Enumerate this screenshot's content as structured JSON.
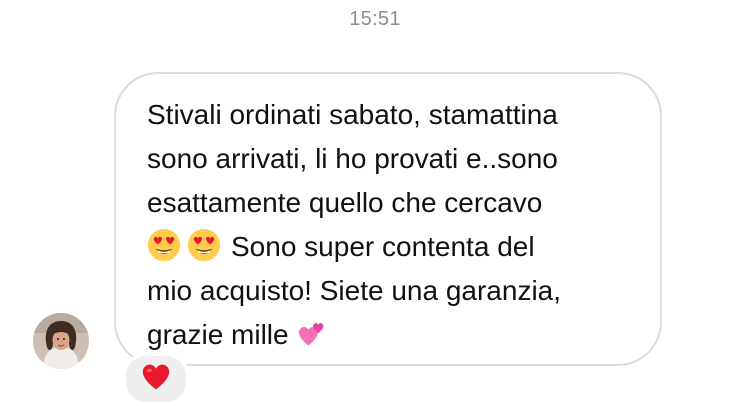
{
  "timestamp": "15:51",
  "message": {
    "lines": [
      {
        "text": "Stivali ordinati sabato, stamattina"
      },
      {
        "text": "sono arrivati, li ho provati e..sono"
      },
      {
        "text": "esattamente quello che cercavo"
      },
      {
        "emojis": [
          "heart-eyes-emoji",
          "heart-eyes-emoji"
        ],
        "text": "Sono super contenta del"
      },
      {
        "text": "mio acquisto! Siete una garanzia,"
      },
      {
        "text": "grazie mille",
        "trailing_emoji": "two-hearts-emoji"
      }
    ]
  },
  "sender": {
    "avatar_icon": "user-avatar"
  },
  "reaction": {
    "icon": "red-heart-emoji"
  },
  "colors": {
    "bubble_border": "#dbdbdb",
    "timestamp_text": "#8e8e8e",
    "reaction_bg": "#efefef",
    "emoji_yellow": "#FFCC4D",
    "heart_red": "#E8192C",
    "two_hearts_pink": "#F46FB6"
  }
}
